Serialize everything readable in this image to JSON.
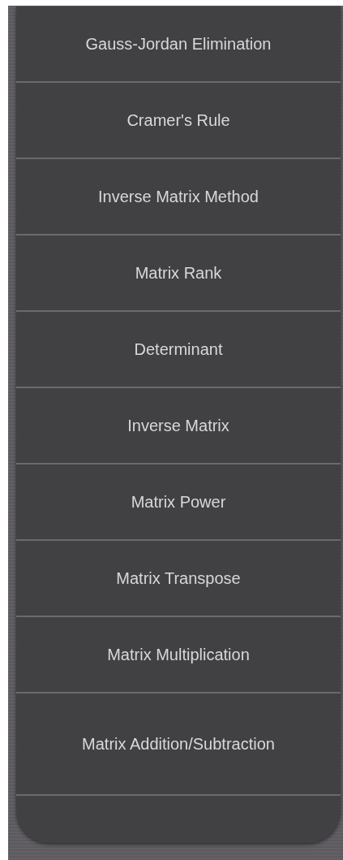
{
  "menu": {
    "items": [
      {
        "label": "Gauss-Jordan Elimination"
      },
      {
        "label": "Cramer's Rule"
      },
      {
        "label": "Inverse Matrix Method"
      },
      {
        "label": "Matrix Rank"
      },
      {
        "label": "Determinant"
      },
      {
        "label": "Inverse Matrix"
      },
      {
        "label": "Matrix Power"
      },
      {
        "label": "Matrix Transpose"
      },
      {
        "label": "Matrix Multiplication"
      },
      {
        "label": "Matrix Addition/Subtraction"
      }
    ]
  }
}
